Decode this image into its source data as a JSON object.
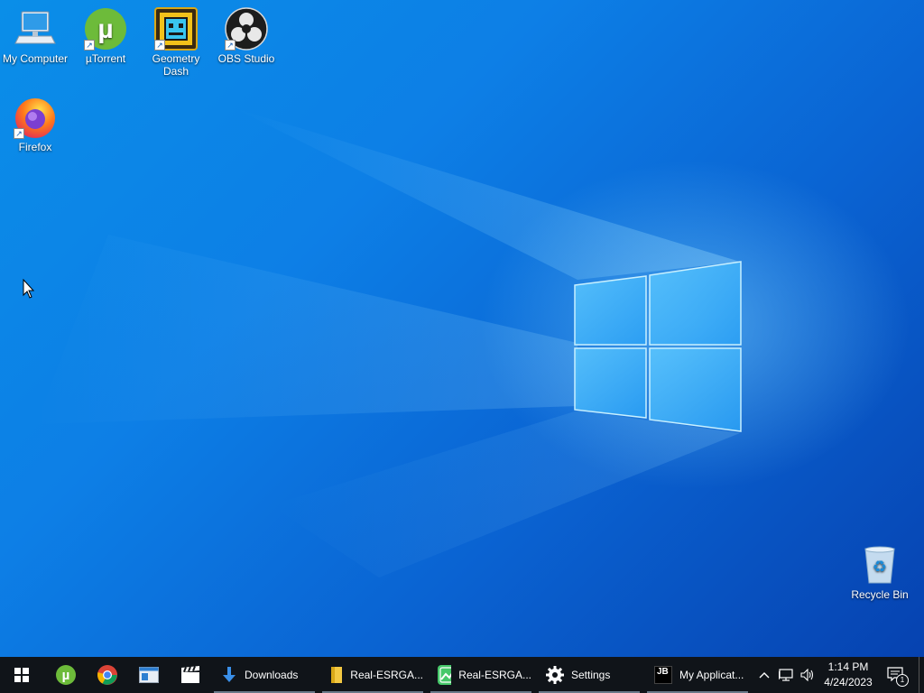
{
  "desktop": {
    "icons": [
      {
        "label": "My Computer"
      },
      {
        "label": "µTorrent"
      },
      {
        "label": "Geometry Dash"
      },
      {
        "label": "OBS Studio"
      },
      {
        "label": "Firefox"
      },
      {
        "label": "Recycle Bin"
      }
    ]
  },
  "taskbar": {
    "apps": [
      {
        "label": "Downloads"
      },
      {
        "label": "Real-ESRGA..."
      },
      {
        "label": "Real-ESRGA..."
      },
      {
        "label": "Settings"
      },
      {
        "label": "My Applicat...",
        "badge": "JB"
      }
    ],
    "clock": {
      "time": "1:14 PM",
      "date": "4/24/2023"
    },
    "notification_count": "1"
  },
  "colors": {
    "taskbar": "#101419",
    "desktop_accent": "#0a7fe6"
  }
}
